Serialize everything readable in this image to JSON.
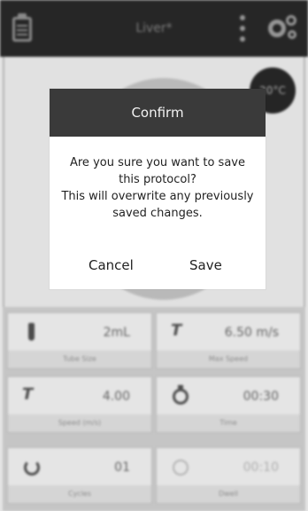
{
  "header": {
    "title": "Liver*",
    "icons": [
      "clipboard-icon",
      "kebab-menu-icon",
      "gears-icon"
    ]
  },
  "temperature_badge": "20°C",
  "tiles": [
    {
      "value": "2mL",
      "label": "Tube Size",
      "icon": "tube-icon",
      "disabled": false
    },
    {
      "value": "6.50 m/s",
      "label": "Max Speed",
      "icon": "runner-icon",
      "disabled": false
    },
    {
      "value": "4.00",
      "label": "Speed (m/s)",
      "icon": "runner-icon",
      "disabled": false
    },
    {
      "value": "00:30",
      "label": "Time",
      "icon": "stopwatch-icon",
      "disabled": false
    },
    {
      "value": "01",
      "label": "Cycles",
      "icon": "cycle-icon",
      "disabled": false
    },
    {
      "value": "00:10",
      "label": "Dwell",
      "icon": "pause-icon",
      "disabled": true
    }
  ],
  "dialog": {
    "title": "Confirm",
    "message_lines": [
      "Are you sure you want to save",
      "this protocol?",
      "This will overwrite any previously",
      "saved changes."
    ],
    "cancel_label": "Cancel",
    "save_label": "Save"
  },
  "colors": {
    "header_bg": "#2b2b2b",
    "dialog_header_bg": "#3a3a3a",
    "tile_label_bg": "#eeeeee"
  }
}
